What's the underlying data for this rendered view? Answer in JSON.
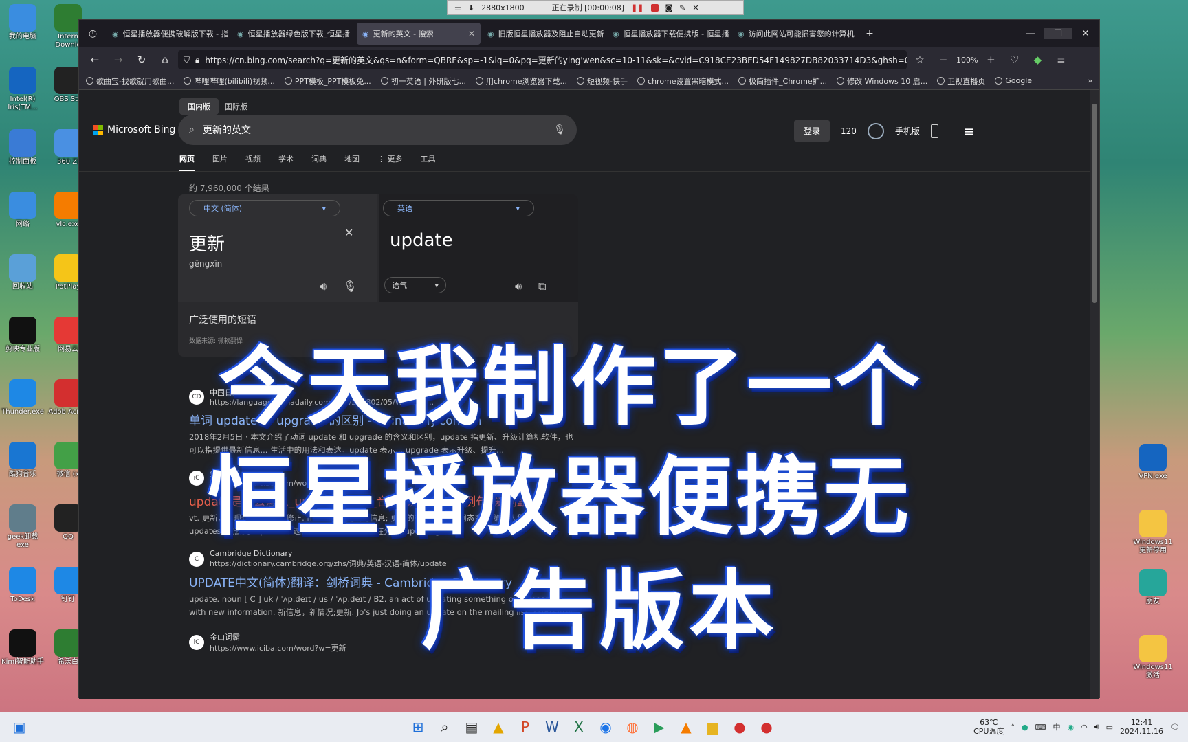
{
  "desktop_left": [
    {
      "label": "我的电脑",
      "icon": "computer-icon",
      "color": "#3a8de0"
    },
    {
      "label": "Intern Downlo",
      "icon": "globe-icon",
      "color": "#2e7d32"
    },
    {
      "label": "Intel(R) Iris(TM...",
      "icon": "intel-icon",
      "color": "#1565c0"
    },
    {
      "label": "OBS Stu",
      "icon": "obs-icon",
      "color": "#222"
    },
    {
      "label": "控制面板",
      "icon": "control-panel-icon",
      "color": "#3a7bd5"
    },
    {
      "label": "360 Zi",
      "icon": "archive-icon",
      "color": "#4a90e2"
    },
    {
      "label": "网络",
      "icon": "network-icon",
      "color": "#3a8de0"
    },
    {
      "label": "vlc.exe",
      "icon": "vlc-icon",
      "color": "#f57c00"
    },
    {
      "label": "回收站",
      "icon": "recycle-bin-icon",
      "color": "#5aa0d8"
    },
    {
      "label": "PotPlay",
      "icon": "potplayer-icon",
      "color": "#f5c518"
    },
    {
      "label": "剪映专业版",
      "icon": "capcut-icon",
      "color": "#111"
    },
    {
      "label": "网易云",
      "icon": "netease-music-icon",
      "color": "#e53935"
    },
    {
      "label": "Thunder.exe",
      "icon": "thunder-icon",
      "color": "#1e88e5"
    },
    {
      "label": "Adob Acrob",
      "icon": "acrobat-icon",
      "color": "#d32f2f"
    },
    {
      "label": "酷狗音乐",
      "icon": "kugou-icon",
      "color": "#1976d2"
    },
    {
      "label": "微信 (x",
      "icon": "wechat-icon",
      "color": "#43a047"
    },
    {
      "label": "geek卸载 exe",
      "icon": "geek-icon",
      "color": "#607d8b"
    },
    {
      "label": "QQ",
      "icon": "qq-icon",
      "color": "#222"
    },
    {
      "label": "ToDesk",
      "icon": "todesk-icon",
      "color": "#1e88e5"
    },
    {
      "label": "钉钉",
      "icon": "dingtalk-icon",
      "color": "#1e88e5"
    },
    {
      "label": "Kimi智能助手",
      "icon": "kimi-icon",
      "color": "#111"
    },
    {
      "label": "希沃白",
      "icon": "en-icon",
      "color": "#2e7d32"
    }
  ],
  "desktop_right": [
    {
      "label": "VPN.exe",
      "icon": "vpn-icon",
      "color": "#1565c0"
    },
    {
      "label": "Windows11 更新停用",
      "icon": "folder-icon",
      "color": "#f4c542"
    },
    {
      "label": "朋友",
      "icon": "user-icon",
      "color": "#26a69a"
    },
    {
      "label": "Windows11 激活",
      "icon": "folder-icon",
      "color": "#f4c542"
    }
  ],
  "recorder": {
    "resolution": "2880x1800",
    "status": "正在录制 [00:00:08]"
  },
  "tabs": [
    {
      "title": "恒星播放器便携破解版下载 - 指",
      "active": false
    },
    {
      "title": "恒星播放器绿色版下载_恒星播",
      "active": false
    },
    {
      "title": "更新的英文 - 搜索",
      "active": true
    },
    {
      "title": "旧版恒星播放器及阻止自动更新",
      "active": false
    },
    {
      "title": "恒星播放器下载便携版 - 恒星播",
      "active": false
    },
    {
      "title": "访问此网站可能损害您的计算机",
      "active": false
    }
  ],
  "url": "https://cn.bing.com/search?q=更新的英文&qs=n&form=QBRE&sp=-1&lq=0&pq=更新的ying'wen&sc=10-11&sk=&cvid=C918CE23BED54F149827DB82033714D3&ghsh=0",
  "zoom": "100%",
  "bookmarks": [
    "歌曲宝-找歌就用歌曲...",
    "哔哩哔哩(bilibili)视频...",
    "PPT模板_PPT模板免...",
    "初一英语 | 外研版七...",
    "用chrome浏览器下载...",
    "短视频-快手",
    "chrome设置黑暗模式...",
    "极简插件_Chrome扩...",
    "修改 Windows 10 启...",
    "卫视直播页",
    "Google"
  ],
  "bing": {
    "regions": [
      "国内版",
      "国际版"
    ],
    "logo": "Microsoft Bing",
    "query": "更新的英文",
    "login": "登录",
    "points": "120",
    "mobile": "手机版",
    "nav": [
      "网页",
      "图片",
      "视频",
      "学术",
      "词典",
      "地图",
      "⋮ 更多",
      "工具"
    ],
    "result_count": "约 7,960,000 个结果"
  },
  "translator": {
    "src_lang": "中文 (简体)",
    "tgt_lang": "英语",
    "src_text": "更新",
    "pinyin": "gēngxīn",
    "tgt_text": "update",
    "tone": "语气",
    "footer": "广泛使用的短语",
    "source": "数据来源: 微软翻译"
  },
  "results": [
    {
      "site": "中国日报网",
      "fav": "CD",
      "url": "https://language.chinadaily.com.cn/a/201802/05/WS5b32...",
      "title": "单词 update 和 upgrade 的区别 - Chinadaily.com.cn",
      "red": false,
      "snippet": "2018年2月5日 · 本文介绍了动词 update 和 upgrade 的含义和区别，update 指更新、升级计算机软件，也可以指提供最新信息... 生活中的用法和表达。update 表示... upgrade 表示升级、提升..."
    },
    {
      "site": "金山词霸",
      "fav": "iC",
      "url": "https://www.iciba.com/word?w=update",
      "title": "update是什么意思_update的翻译_音标_读音_用法_例句_爱词霸",
      "red": true,
      "snippet": "vt. 更新，使现代化; 校正，修正. n. 现代化; 更新的信息; 更新的行为或实例. 词态变化 第三人称单数: updates; 过去式: updated; 过去分词: updated; 现在分词: updating..."
    },
    {
      "site": "Cambridge Dictionary",
      "fav": "C",
      "url": "https://dictionary.cambridge.org/zhs/词典/英语-汉语-简体/update",
      "title": "UPDATE中文(简体)翻译：剑桥词典 - Cambridge Dictionary",
      "red": false,
      "snippet": "update. noun [ C ] uk / ˈʌp.deɪt / us / ˈʌp.deɪt / B2. an act of updating something or someone with new information. 新信息，新情况;更新. Jo's just doing an update on the mailing list. 乔正在更新 ..."
    },
    {
      "site": "金山词霸",
      "fav": "iC",
      "url": "https://www.iciba.com/word?w=更新",
      "title": "",
      "red": false,
      "snippet": ""
    }
  ],
  "overlay": {
    "line1": "今天我制作了一个",
    "line2": "恒星播放器便携无",
    "line3": "广告版本"
  },
  "taskbar": {
    "apps": [
      "start-icon",
      "search-icon",
      "taskview-icon",
      "app-icon",
      "powerpoint-icon",
      "word-icon",
      "excel-icon",
      "chrome-icon",
      "firefox-icon",
      "media-icon",
      "vlc-icon",
      "explorer-icon",
      "record-icon",
      "record-icon"
    ],
    "temp": "63℃",
    "temp_label": "CPU温度",
    "ime": "中",
    "time": "12:41",
    "date": "2024.11.16"
  }
}
